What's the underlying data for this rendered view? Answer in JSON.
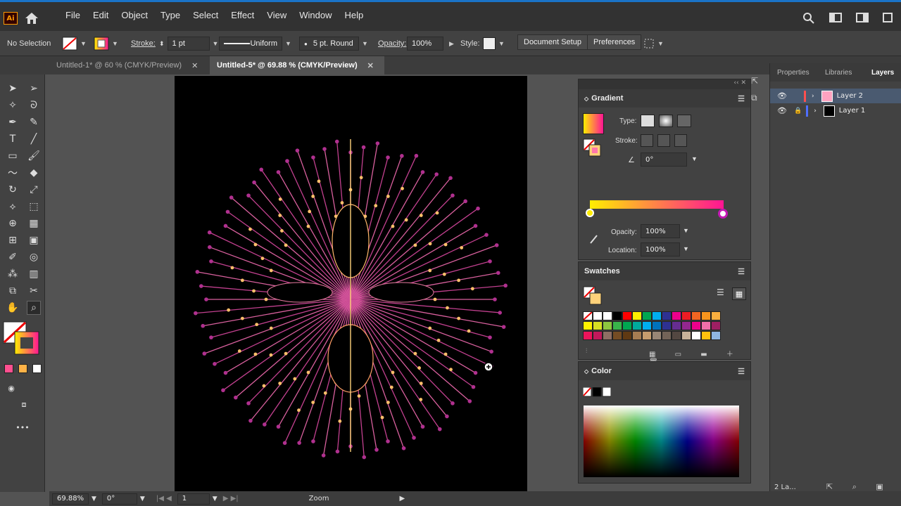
{
  "app": {
    "logo": "Ai"
  },
  "menu": [
    "File",
    "Edit",
    "Object",
    "Type",
    "Select",
    "Effect",
    "View",
    "Window",
    "Help"
  ],
  "control": {
    "selection": "No Selection",
    "stroke_label": "Stroke:",
    "stroke_value": "1 pt",
    "profile": "Uniform",
    "brush": "5 pt. Round",
    "opacity_label": "Opacity:",
    "opacity_value": "100%",
    "style_label": "Style:",
    "doc_setup": "Document Setup",
    "preferences": "Preferences"
  },
  "tabs": [
    {
      "label": "Untitled-1* @ 60 % (CMYK/Preview)",
      "active": false
    },
    {
      "label": "Untitled-5* @ 69.88 % (CMYK/Preview)",
      "active": true
    }
  ],
  "gradient": {
    "title": "Gradient",
    "type_label": "Type:",
    "stroke_label": "Stroke:",
    "angle": "0°",
    "opacity_label": "Opacity:",
    "opacity_value": "100%",
    "location_label": "Location:",
    "location_value": "100%",
    "colors": {
      "start": "#ffee00",
      "end": "#ff1493"
    }
  },
  "swatches": {
    "title": "Swatches"
  },
  "color": {
    "title": "Color"
  },
  "layers_tabs": [
    "Properties",
    "Libraries",
    "Layers"
  ],
  "layers": [
    {
      "name": "Layer 2",
      "color": "#ff4f4f",
      "selected": true
    },
    {
      "name": "Layer 1",
      "color": "#4f6fff",
      "selected": false
    }
  ],
  "layers_footer": "2 La...",
  "status": {
    "zoom": "69.88%",
    "rotation": "0°",
    "artboard": "1",
    "tool": "Zoom"
  }
}
